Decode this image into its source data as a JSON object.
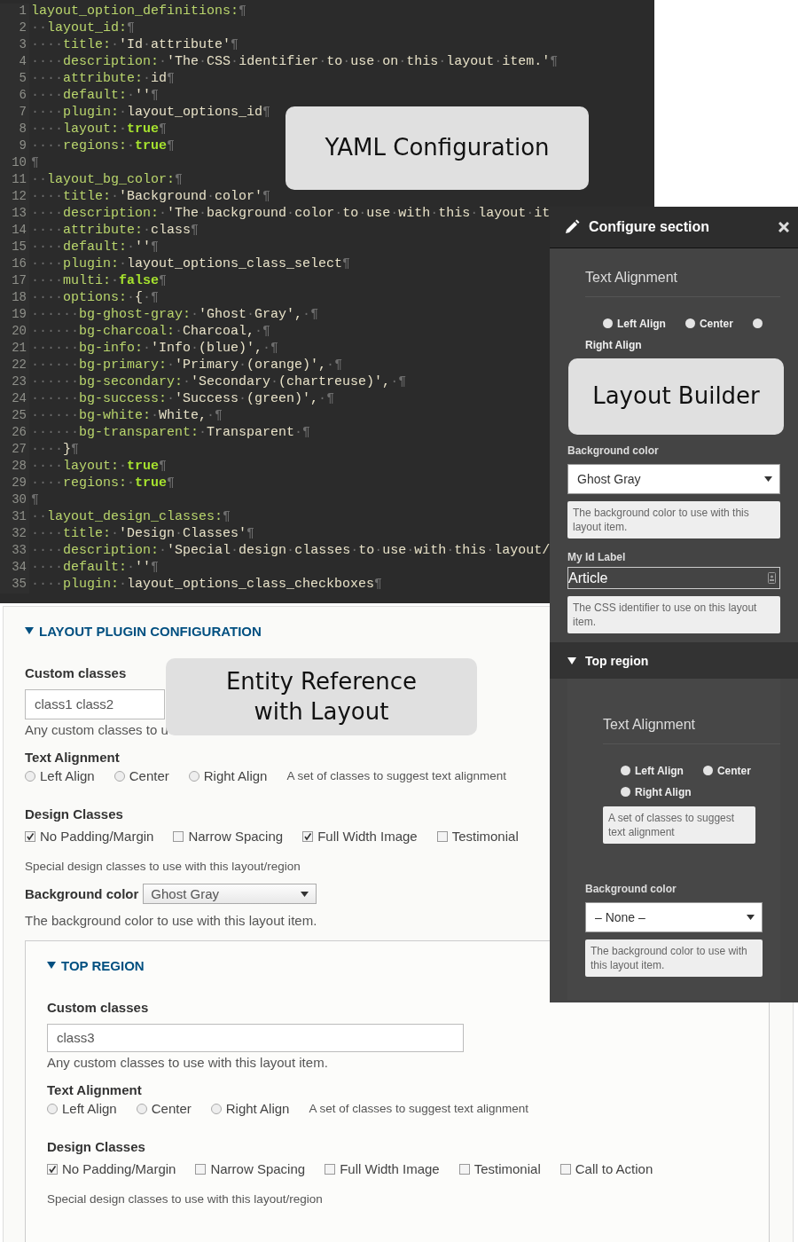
{
  "editor": {
    "lines": [
      {
        "num": "1",
        "key": "layout_option_definitions:",
        "kind": "text",
        "end": "¶"
      },
      {
        "num": "2",
        "indent": "··",
        "key": "layout_id:",
        "kind": "text",
        "end": "¶"
      },
      {
        "num": "3",
        "indent": "····",
        "key": "title:",
        "value": "·'Id·attribute'",
        "kind": "text",
        "end": "¶"
      },
      {
        "num": "4",
        "indent": "····",
        "key": "description:",
        "value": "·'The·CSS·identifier·to·use·on·this·layout·item.'",
        "kind": "text",
        "end": "¶"
      },
      {
        "num": "5",
        "indent": "····",
        "key": "attribute:",
        "value": "·id",
        "kind": "text",
        "end": "¶"
      },
      {
        "num": "6",
        "indent": "····",
        "key": "default:",
        "value": "·''",
        "kind": "text",
        "end": "¶"
      },
      {
        "num": "7",
        "indent": "····",
        "key": "plugin:",
        "value": "·layout_options_id",
        "kind": "text",
        "end": "¶"
      },
      {
        "num": "8",
        "indent": "····",
        "key": "layout:",
        "value": "·true",
        "kind": "bool",
        "end": "¶"
      },
      {
        "num": "9",
        "indent": "····",
        "key": "regions:",
        "value": "·true",
        "kind": "bool",
        "end": "¶"
      },
      {
        "num": "10",
        "kind": "text",
        "end": "¶"
      },
      {
        "num": "11",
        "indent": "··",
        "key": "layout_bg_color:",
        "kind": "text",
        "end": "¶"
      },
      {
        "num": "12",
        "indent": "····",
        "key": "title:",
        "value": "·'Background·color'",
        "kind": "text",
        "end": "¶"
      },
      {
        "num": "13",
        "indent": "····",
        "key": "description:",
        "value": "·'The·background·color·to·use·with·this·layout·it",
        "kind": "text"
      },
      {
        "num": "14",
        "indent": "····",
        "key": "attribute:",
        "value": "·class",
        "kind": "text",
        "end": "¶"
      },
      {
        "num": "15",
        "indent": "····",
        "key": "default:",
        "value": "·''",
        "kind": "text",
        "end": "¶"
      },
      {
        "num": "16",
        "indent": "····",
        "key": "plugin:",
        "value": "·layout_options_class_select",
        "kind": "text",
        "end": "¶"
      },
      {
        "num": "17",
        "indent": "····",
        "key": "multi:",
        "value": "·false",
        "kind": "bool",
        "end": "¶"
      },
      {
        "num": "18",
        "indent": "····",
        "key": "options:",
        "value": "·{·",
        "kind": "text",
        "end": "¶"
      },
      {
        "num": "19",
        "indent": "······",
        "key": "bg-ghost-gray:",
        "value": "·'Ghost·Gray',·",
        "kind": "text",
        "end": "¶"
      },
      {
        "num": "20",
        "indent": "······",
        "key": "bg-charcoal:",
        "value": "·Charcoal,·",
        "kind": "text",
        "end": "¶"
      },
      {
        "num": "21",
        "indent": "······",
        "key": "bg-info:",
        "value": "·'Info·(blue)',·",
        "kind": "text",
        "end": "¶"
      },
      {
        "num": "22",
        "indent": "······",
        "key": "bg-primary:",
        "value": "·'Primary·(orange)',·",
        "kind": "text",
        "end": "¶"
      },
      {
        "num": "23",
        "indent": "······",
        "key": "bg-secondary:",
        "value": "·'Secondary·(chartreuse)',·",
        "kind": "text",
        "end": "¶"
      },
      {
        "num": "24",
        "indent": "······",
        "key": "bg-success:",
        "value": "·'Success·(green)',·",
        "kind": "text",
        "end": "¶"
      },
      {
        "num": "25",
        "indent": "······",
        "key": "bg-white:",
        "value": "·White,·",
        "kind": "text",
        "end": "¶"
      },
      {
        "num": "26",
        "indent": "······",
        "key": "bg-transparent:",
        "value": "·Transparent·",
        "kind": "text",
        "end": "¶"
      },
      {
        "num": "27",
        "indent": "····",
        "value": "}",
        "kind": "text",
        "end": "¶"
      },
      {
        "num": "28",
        "indent": "····",
        "key": "layout:",
        "value": "·true",
        "kind": "bool",
        "end": "¶"
      },
      {
        "num": "29",
        "indent": "····",
        "key": "regions:",
        "value": "·true",
        "kind": "bool",
        "end": "¶"
      },
      {
        "num": "30",
        "kind": "text",
        "end": "¶"
      },
      {
        "num": "31",
        "indent": "··",
        "key": "layout_design_classes:",
        "kind": "text",
        "end": "¶"
      },
      {
        "num": "32",
        "indent": "····",
        "key": "title:",
        "value": "·'Design·Classes'",
        "kind": "text",
        "end": "¶"
      },
      {
        "num": "33",
        "indent": "····",
        "key": "description:",
        "value": "·'Special·design·classes·to·use·with·this·layout/",
        "kind": "text"
      },
      {
        "num": "34",
        "indent": "····",
        "key": "default:",
        "value": "·''",
        "kind": "text",
        "end": "¶"
      },
      {
        "num": "35",
        "indent": "····",
        "key": "plugin:",
        "value": "·layout_options_class_checkboxes",
        "kind": "text",
        "end": "¶"
      }
    ]
  },
  "yaml_callout": "YAML Configuration",
  "form": {
    "title": "LAYOUT PLUGIN CONFIGURATION",
    "expanded": true,
    "custom_classes": {
      "label": "Custom classes",
      "value": "class1 class2",
      "description": "Any custom classes to u"
    },
    "text_alignment": {
      "label": "Text Alignment",
      "options": [
        {
          "label": "Left Align",
          "selected": false
        },
        {
          "label": "Center",
          "selected": false
        },
        {
          "label": "Right Align",
          "selected": false
        }
      ],
      "description": "A set of classes to suggest text alignment"
    },
    "design_classes": {
      "label": "Design Classes",
      "options": [
        {
          "label": "No Padding/Margin",
          "checked": true
        },
        {
          "label": "Narrow Spacing",
          "checked": false
        },
        {
          "label": "Full Width Image",
          "checked": true
        },
        {
          "label": "Testimonial",
          "checked": false
        }
      ],
      "description": "Special design classes to use with this layout/region"
    },
    "background_color": {
      "label": "Background color",
      "value": "Ghost Gray",
      "description": "The background color to use with this layout item."
    },
    "top_region": {
      "title": "TOP REGION",
      "expanded": true,
      "custom_classes": {
        "label": "Custom classes",
        "value": "class3",
        "description": "Any custom classes to use with this layout item."
      },
      "text_alignment": {
        "label": "Text Alignment",
        "options": [
          {
            "label": "Left Align",
            "selected": false
          },
          {
            "label": "Center",
            "selected": false
          },
          {
            "label": "Right Align",
            "selected": false
          }
        ],
        "description": "A set of classes to suggest text alignment"
      },
      "design_classes": {
        "label": "Design Classes",
        "options": [
          {
            "label": "No Padding/Margin",
            "checked": true
          },
          {
            "label": "Narrow Spacing",
            "checked": false
          },
          {
            "label": "Full Width Image",
            "checked": false
          },
          {
            "label": "Testimonial",
            "checked": false
          },
          {
            "label": "Call to Action",
            "checked": false
          }
        ],
        "description": "Special design classes to use with this layout/region"
      }
    }
  },
  "entity_callout": [
    "Entity Reference",
    "with Layout"
  ],
  "config_panel": {
    "title": "Configure section",
    "text_alignment": {
      "heading": "Text Alignment",
      "options": [
        {
          "label": "Left Align",
          "selected": false
        },
        {
          "label": "Center",
          "selected": false
        },
        {
          "label": "Right Align",
          "selected": false
        }
      ]
    },
    "background_color": {
      "label": "Background color",
      "value": "Ghost Gray",
      "description": "The background color to use with this layout item."
    },
    "id_field": {
      "label": "My Id Label",
      "value": "Article",
      "description": "The CSS identifier to use on this layout item."
    },
    "top_region": {
      "title": "Top region",
      "expanded": true,
      "text_alignment": {
        "heading": "Text Alignment",
        "options": [
          {
            "label": "Left Align",
            "selected": false
          },
          {
            "label": "Center",
            "selected": false
          },
          {
            "label": "Right Align",
            "selected": false
          }
        ],
        "description": "A set of classes to suggest text alignment"
      },
      "background_color": {
        "label": "Background color",
        "value": "– None –",
        "description": "The background color to use with this layout item."
      }
    }
  },
  "layout_callout": "Layout Builder"
}
